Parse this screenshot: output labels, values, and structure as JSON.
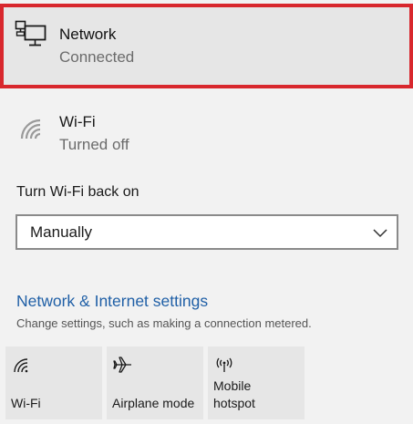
{
  "network": {
    "title": "Network",
    "status": "Connected",
    "icon": "ethernet-network-icon",
    "highlight_color": "#d8272d"
  },
  "wifi": {
    "title": "Wi-Fi",
    "status": "Turned off",
    "icon": "wifi-off-icon"
  },
  "turn_wifi_on": {
    "label": "Turn Wi-Fi back on",
    "selected": "Manually"
  },
  "settings": {
    "link": "Network & Internet settings",
    "description": "Change settings, such as making a connection metered.",
    "link_color": "#1f5fa6"
  },
  "quick_actions": [
    {
      "label": "Wi-Fi",
      "icon": "wifi-icon"
    },
    {
      "label": "Airplane mode",
      "icon": "airplane-icon"
    },
    {
      "label": "Mobile hotspot",
      "icon": "hotspot-icon"
    }
  ]
}
